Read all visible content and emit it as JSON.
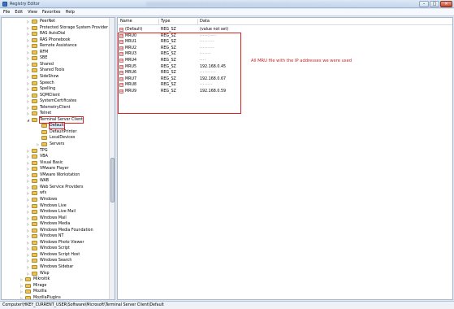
{
  "window": {
    "title": "Registry Editor",
    "controls": [
      "–",
      "□",
      "✕"
    ]
  },
  "menu": [
    "File",
    "Edit",
    "View",
    "Favorites",
    "Help"
  ],
  "tree": {
    "items": [
      {
        "label": "PeerNet",
        "level": 2,
        "expand": "▷"
      },
      {
        "label": "Protected Storage System Provider",
        "level": 2,
        "expand": "▷"
      },
      {
        "label": "RAS AutoDial",
        "level": 2,
        "expand": "▷"
      },
      {
        "label": "RAS Phonebook",
        "level": 2,
        "expand": "▷"
      },
      {
        "label": "Remote Assistance",
        "level": 2,
        "expand": "▷"
      },
      {
        "label": "RFM",
        "level": 2,
        "expand": "▷"
      },
      {
        "label": "SBE",
        "level": 2,
        "expand": "▷"
      },
      {
        "label": "Shared",
        "level": 2,
        "expand": "▷"
      },
      {
        "label": "Shared Tools",
        "level": 2,
        "expand": "▷"
      },
      {
        "label": "SideShow",
        "level": 2,
        "expand": "▷"
      },
      {
        "label": "Speech",
        "level": 2,
        "expand": "▷"
      },
      {
        "label": "Spelling",
        "level": 2,
        "expand": "▷"
      },
      {
        "label": "SQMClient",
        "level": 2,
        "expand": "▷"
      },
      {
        "label": "SystemCertificates",
        "level": 2,
        "expand": "▷"
      },
      {
        "label": "TelemetryClient",
        "level": 2,
        "expand": "▷"
      },
      {
        "label": "Telnet",
        "level": 2,
        "expand": "▷"
      },
      {
        "label": "Terminal Server Client",
        "level": 2,
        "expand": "◢",
        "highlight": "red"
      },
      {
        "label": "Default",
        "level": 3,
        "expand": "",
        "highlight": "red-selected"
      },
      {
        "label": "DefaultPrinter",
        "level": 3,
        "expand": ""
      },
      {
        "label": "LocalDevices",
        "level": 3,
        "expand": ""
      },
      {
        "label": "Servers",
        "level": 3,
        "expand": "▷"
      },
      {
        "label": "TPG",
        "level": 2,
        "expand": "▷"
      },
      {
        "label": "VBA",
        "level": 2,
        "expand": "▷"
      },
      {
        "label": "Visual Basic",
        "level": 2,
        "expand": "▷"
      },
      {
        "label": "VMware Player",
        "level": 2,
        "expand": "▷"
      },
      {
        "label": "VMware Workstation",
        "level": 2,
        "expand": "▷"
      },
      {
        "label": "WAB",
        "level": 2,
        "expand": "▷"
      },
      {
        "label": "Web Service Providers",
        "level": 2,
        "expand": "▷"
      },
      {
        "label": "wfs",
        "level": 2,
        "expand": "▷"
      },
      {
        "label": "Windows",
        "level": 2,
        "expand": "▷"
      },
      {
        "label": "Windows Live",
        "level": 2,
        "expand": "▷"
      },
      {
        "label": "Windows Live Mail",
        "level": 2,
        "expand": "▷"
      },
      {
        "label": "Windows Mail",
        "level": 2,
        "expand": "▷"
      },
      {
        "label": "Windows Media",
        "level": 2,
        "expand": "▷"
      },
      {
        "label": "Windows Media Foundation",
        "level": 2,
        "expand": "▷"
      },
      {
        "label": "Windows NT",
        "level": 2,
        "expand": "▷"
      },
      {
        "label": "Windows Photo Viewer",
        "level": 2,
        "expand": "▷"
      },
      {
        "label": "Windows Script",
        "level": 2,
        "expand": "▷"
      },
      {
        "label": "Windows Script Host",
        "level": 2,
        "expand": "▷"
      },
      {
        "label": "Windows Search",
        "level": 2,
        "expand": "▷"
      },
      {
        "label": "Windows Sidebar",
        "level": 2,
        "expand": "▷"
      },
      {
        "label": "Wisp",
        "level": 2,
        "expand": "▷"
      },
      {
        "label": "Mikroitik",
        "level": 1,
        "expand": "▷"
      },
      {
        "label": "Mirage",
        "level": 1,
        "expand": "▷"
      },
      {
        "label": "Mozilla",
        "level": 1,
        "expand": "▷"
      },
      {
        "label": "MozillaPlugins",
        "level": 1,
        "expand": "▷"
      }
    ]
  },
  "list": {
    "columns": [
      "Name",
      "Type",
      "Data"
    ],
    "rows": [
      {
        "name": "(Default)",
        "type": "REG_SZ",
        "data": "(value not set)"
      },
      {
        "name": "MRU0",
        "type": "REG_SZ",
        "data": "·····:····"
      },
      {
        "name": "MRU1",
        "type": "REG_SZ",
        "data": "·········"
      },
      {
        "name": "MRU2",
        "type": "REG_SZ",
        "data": "·········"
      },
      {
        "name": "MRU3",
        "type": "REG_SZ",
        "data": "·······"
      },
      {
        "name": "MRU4",
        "type": "REG_SZ",
        "data": "····"
      },
      {
        "name": "MRU5",
        "type": "REG_SZ",
        "data": "192.168.0.45"
      },
      {
        "name": "MRU6",
        "type": "REG_SZ",
        "data": "··········"
      },
      {
        "name": "MRU7",
        "type": "REG_SZ",
        "data": "192.168.0.67"
      },
      {
        "name": "MRU8",
        "type": "REG_SZ",
        "data": "········"
      },
      {
        "name": "MRU9",
        "type": "REG_SZ",
        "data": "192.168.0.59"
      }
    ],
    "annotation": "All MRU file with the IP addresses we were used"
  },
  "status": {
    "path": "Computer\\HKEY_CURRENT_USER\\Software\\Microsoft\\Terminal Server Client\\Default"
  },
  "colors": {
    "highlight": "#d22222",
    "selection": "#dbe8f7",
    "folder": "#e8c35a"
  }
}
